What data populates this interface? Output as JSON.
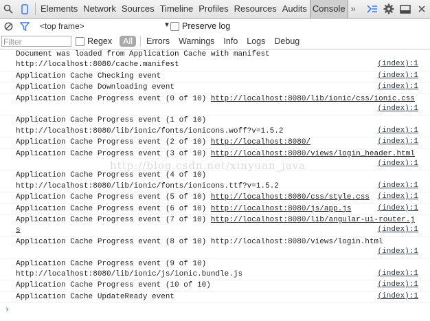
{
  "tabs": {
    "items": [
      "Elements",
      "Network",
      "Sources",
      "Timeline",
      "Profiles",
      "Resources",
      "Audits",
      "Console"
    ],
    "active": "Console",
    "more": "»"
  },
  "toolbar": {
    "frame": "<top frame>",
    "preserve_log": "Preserve log",
    "filter_placeholder": "Filter",
    "regex": "Regex",
    "all": "All",
    "levels": [
      "Errors",
      "Warnings",
      "Info",
      "Logs",
      "Debug"
    ]
  },
  "watermark": "http://blog.csdn.net/xinyuan_java",
  "console": {
    "messages": [
      {
        "text": "Document was loaded from Application Cache with manifest",
        "line2": "http://localhost:8080/cache.manifest",
        "link": "",
        "src": "(index):1"
      },
      {
        "text": "Application Cache Checking event",
        "line2": "",
        "link": "",
        "src": "(index):1"
      },
      {
        "text": "Application Cache Downloading event",
        "line2": "",
        "link": "",
        "src": "(index):1"
      },
      {
        "text": "Application Cache Progress event (0 of 10) ",
        "line2": "",
        "link": "http://localhost:8080/lib/ionic/css/ionic.css",
        "src": "(index):1",
        "two_line": true
      },
      {
        "text": "Application Cache Progress event (1 of 10)",
        "line2": "http://localhost:8080/lib/ionic/fonts/ionicons.woff?v=1.5.2",
        "link": "",
        "src": "(index):1"
      },
      {
        "text": "Application Cache Progress event (2 of 10) ",
        "line2": "",
        "link": "http://localhost:8080/",
        "src": "(index):1"
      },
      {
        "text": "Application Cache Progress event (3 of 10) ",
        "line2": "",
        "link": "http://localhost:8080/views/login_header.html",
        "src": "(index):1",
        "two_line": true
      },
      {
        "text": "Application Cache Progress event (4 of 10)",
        "line2": "http://localhost:8080/lib/ionic/fonts/ionicons.ttf?v=1.5.2",
        "link": "",
        "src": "(index):1"
      },
      {
        "text": "Application Cache Progress event (5 of 10) ",
        "line2": "",
        "link": "http://localhost:8080/css/style.css",
        "src": "(index):1"
      },
      {
        "text": "Application Cache Progress event (6 of 10) ",
        "line2": "",
        "link": "http://localhost:8080/js/app.js",
        "src": "(index):1"
      },
      {
        "text": "Application Cache Progress event (7 of 10) ",
        "line2": "",
        "link": "http://localhost:8080/lib/angular-ui-router.js",
        "src": "(index):1"
      },
      {
        "text": "Application Cache Progress event (8 of 10) http://localhost:8080/views/login.html",
        "line2": "",
        "link": "",
        "src": "(index):1",
        "two_line": true
      },
      {
        "text": "Application Cache Progress event (9 of 10)",
        "line2": "http://localhost:8080/lib/ionic/js/ionic.bundle.js",
        "link": "",
        "src": "(index):1"
      },
      {
        "text": "Application Cache Progress event (10 of 10)",
        "line2": "",
        "link": "",
        "src": "(index):1"
      },
      {
        "text": "Application Cache UpdateReady event",
        "line2": "",
        "link": "",
        "src": "(index):1"
      }
    ],
    "prompt": "›"
  }
}
